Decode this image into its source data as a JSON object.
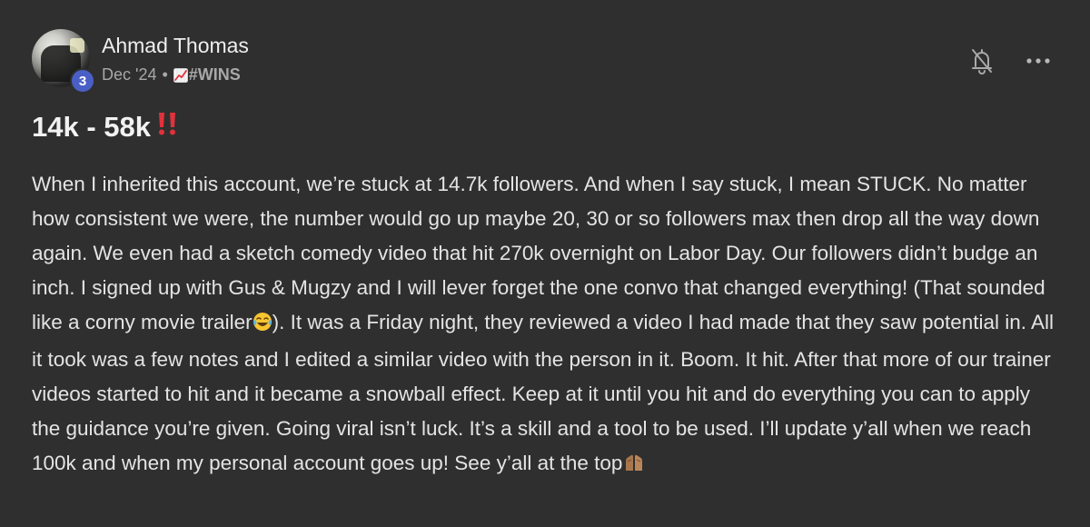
{
  "post": {
    "author": "Ahmad Thomas",
    "level": "3",
    "date": "Dec '24",
    "separator": "•",
    "category_icon": "chart-increasing-emoji",
    "category": "#WINS",
    "title": "14k - 58k",
    "title_emoji": "double-exclamation-emoji",
    "body_part1": "When I inherited this account, we’re stuck at 14.7k followers. And when I say stuck, I mean STUCK. No matter how consistent we were, the number would go up maybe 20, 30 or so followers max then drop all the way down again. We even had a sketch comedy video that hit 270k overnight on Labor Day. Our followers didn’t budge an inch. I signed up with Gus & Mugzy and I will lever forget the one convo that changed everything! (That sounded like a corny movie trailer",
    "body_emoji1": "tears-of-joy-emoji",
    "body_part2": "). It was a Friday night, they reviewed a video I had made that they saw potential in. All it took was a few notes and I edited a similar video with the person in it. Boom. It hit. After that more of our trainer videos started to hit and it became a snowball effect. Keep at it until you hit and do everything you can to apply the guidance you’re given. Going viral isn’t luck. It’s a skill and a tool to be used. I’ll update y’all when we reach 100k and when my personal account goes up! See y’all at the top",
    "body_emoji2": "praying-hands-emoji"
  },
  "actions": {
    "notifications_icon": "bell-off-icon",
    "more_icon": "more-horizontal-icon"
  },
  "colors": {
    "background": "#2f2f2f",
    "text": "#e4e4e4",
    "meta": "#a8a8a8",
    "badge": "#4a5fc6",
    "exclamation": "#e0323c"
  }
}
